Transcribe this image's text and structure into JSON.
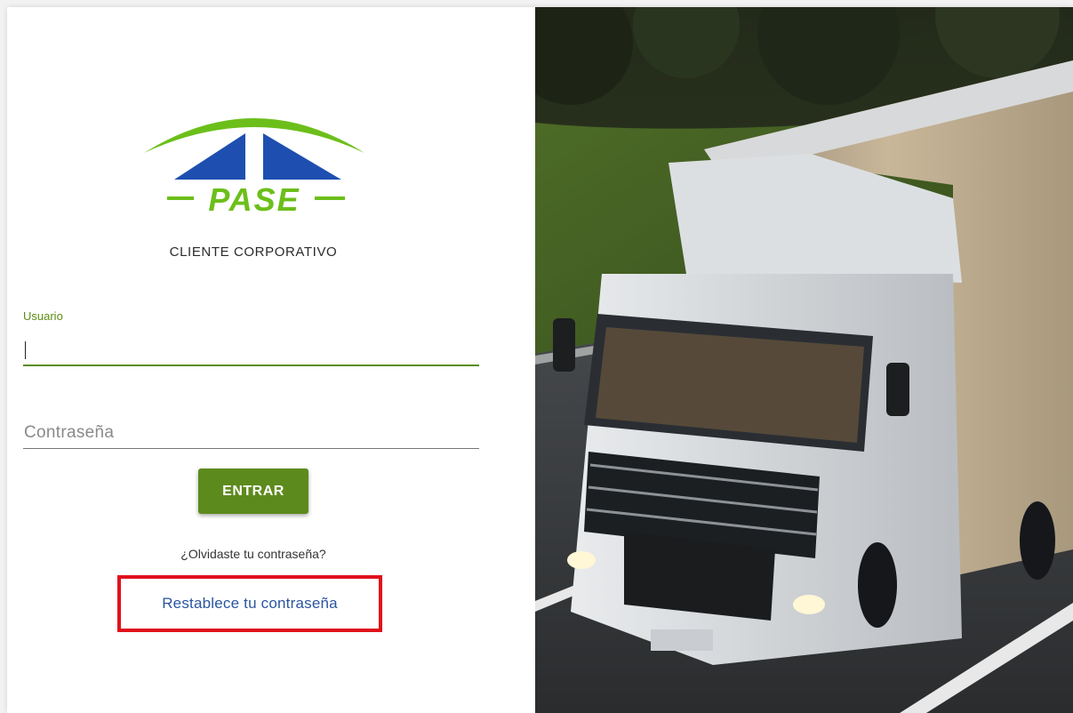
{
  "brand": {
    "logo_text": "PASE",
    "subtitle": "CLIENTE CORPORATIVO",
    "colors": {
      "green": "#6cbf1a",
      "blue": "#1e4fb0",
      "button_green": "#5d8a1d",
      "link_blue": "#2a55a0",
      "highlight_red": "#e0111b"
    }
  },
  "login": {
    "user_label": "Usuario",
    "user_value": "",
    "password_placeholder": "Contraseña",
    "password_value": "",
    "submit_label": "ENTRAR",
    "forgot_text": "¿Olvidaste tu contraseña?",
    "reset_link": "Restablece tu contraseña"
  },
  "hero": {
    "image_subject": "white semi truck on highway",
    "icon": "truck-photo"
  }
}
